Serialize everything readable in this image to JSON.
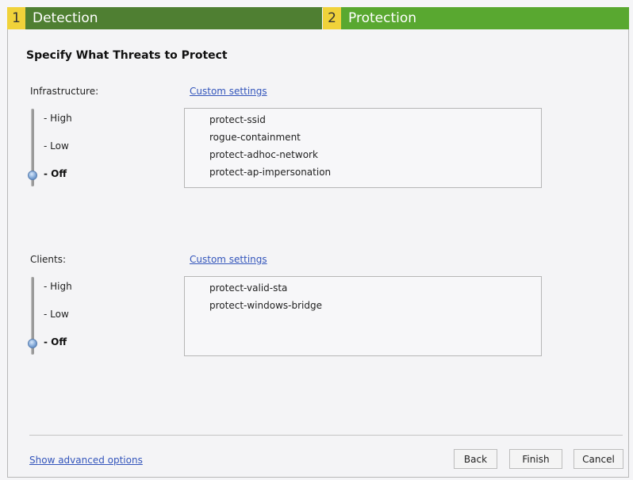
{
  "wizard": {
    "steps": [
      {
        "number": "1",
        "label": "Detection"
      },
      {
        "number": "2",
        "label": "Protection"
      }
    ],
    "heading": "Specify What Threats to Protect"
  },
  "infrastructure": {
    "label": "Infrastructure:",
    "custom_link": "Custom settings",
    "levels": [
      "- High",
      "- Low",
      "- Off"
    ],
    "selected_level": "- Off",
    "items": [
      "protect-ssid",
      "rogue-containment",
      "protect-adhoc-network",
      "protect-ap-impersonation"
    ]
  },
  "clients": {
    "label": "Clients:",
    "custom_link": "Custom settings",
    "levels": [
      "- High",
      "- Low",
      "- Off"
    ],
    "selected_level": "- Off",
    "items": [
      "protect-valid-sta",
      "protect-windows-bridge"
    ]
  },
  "footer": {
    "advanced_link": "Show advanced options",
    "back_label": "Back",
    "finish_label": "Finish",
    "cancel_label": "Cancel"
  },
  "colors": {
    "step_number_bg": "#f0d23a",
    "step1_bg": "#4f7f32",
    "step2_bg": "#59a830",
    "link": "#3355bb"
  },
  "icons": [
    "slider-thumb-icon"
  ]
}
